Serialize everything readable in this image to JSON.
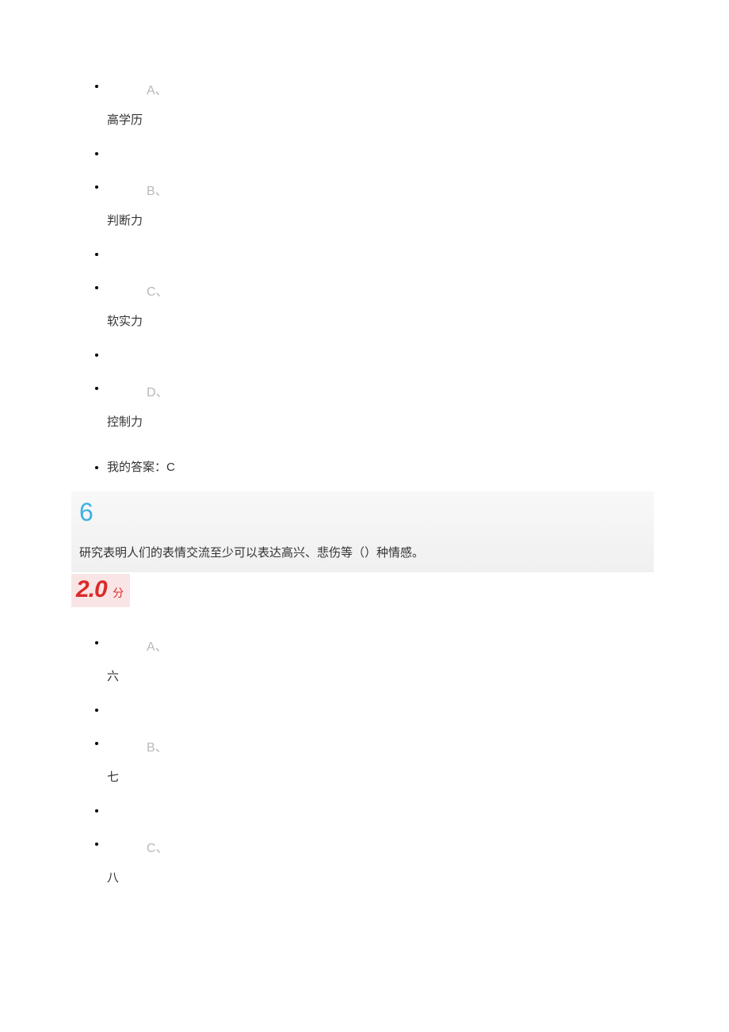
{
  "question5": {
    "options": [
      {
        "letter": "A、",
        "text": "高学历"
      },
      {
        "letter": "B、",
        "text": "判断力"
      },
      {
        "letter": "C、",
        "text": "软实力"
      },
      {
        "letter": "D、",
        "text": "控制力"
      }
    ],
    "answer_label": "我的答案：C"
  },
  "question6": {
    "number": "6",
    "text": "研究表明人们的表情交流至少可以表达高兴、悲伤等（）种情感。",
    "score_value": "2.0",
    "score_unit": "分",
    "options": [
      {
        "letter": "A、",
        "text": "六"
      },
      {
        "letter": "B、",
        "text": "七"
      },
      {
        "letter": "C、",
        "text": "八"
      }
    ]
  }
}
